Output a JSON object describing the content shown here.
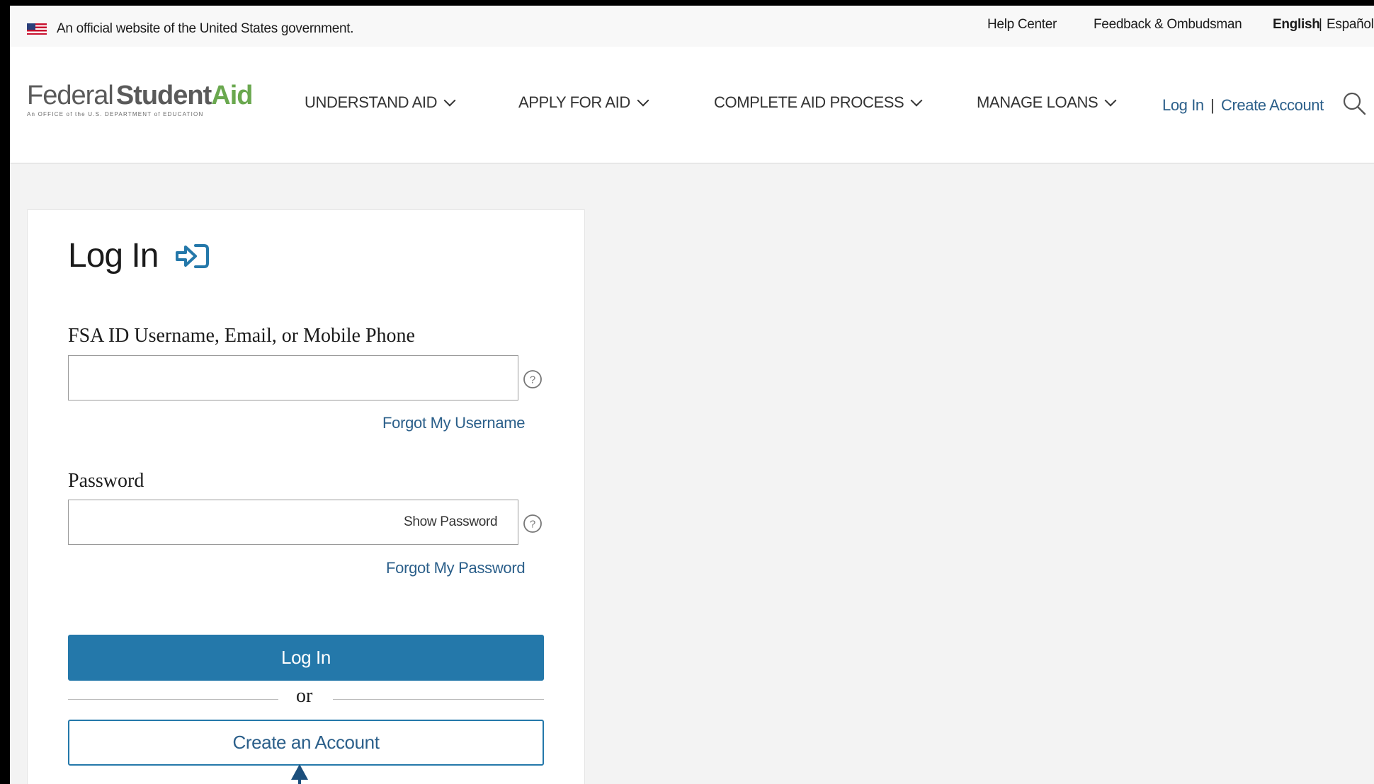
{
  "gov_banner": {
    "text": "An official website of the United States government.",
    "help_center": "Help Center",
    "feedback": "Feedback & Ombudsman",
    "lang_english": "English",
    "lang_separator": "|",
    "lang_espanol": "Español"
  },
  "header": {
    "logo": {
      "federal": "Federal",
      "student": "Student",
      "aid": "Aid",
      "subtitle": "An OFFICE of the U.S. DEPARTMENT of EDUCATION"
    },
    "nav": [
      {
        "label": "UNDERSTAND AID"
      },
      {
        "label": "APPLY FOR AID"
      },
      {
        "label": "COMPLETE AID PROCESS"
      },
      {
        "label": "MANAGE LOANS"
      }
    ],
    "log_in": "Log In",
    "separator": "|",
    "create_account": "Create Account",
    "search_icon": "search-icon"
  },
  "login": {
    "title": "Log In",
    "title_icon": "login-arrow-icon",
    "username_label": "FSA ID Username, Email, or Mobile Phone",
    "username_value": "",
    "forgot_username": "Forgot My Username",
    "password_label": "Password",
    "password_value": "",
    "show_password": "Show Password",
    "forgot_password": "Forgot My Password",
    "login_button": "Log In",
    "or_text": "or",
    "create_button": "Create an Account",
    "help_icon": "question-circle-icon"
  },
  "colors": {
    "primary": "#2478aa",
    "link": "#2b5f8a",
    "logo_green": "#6aa84f",
    "annotation_arrow": "#1c4f7c"
  }
}
